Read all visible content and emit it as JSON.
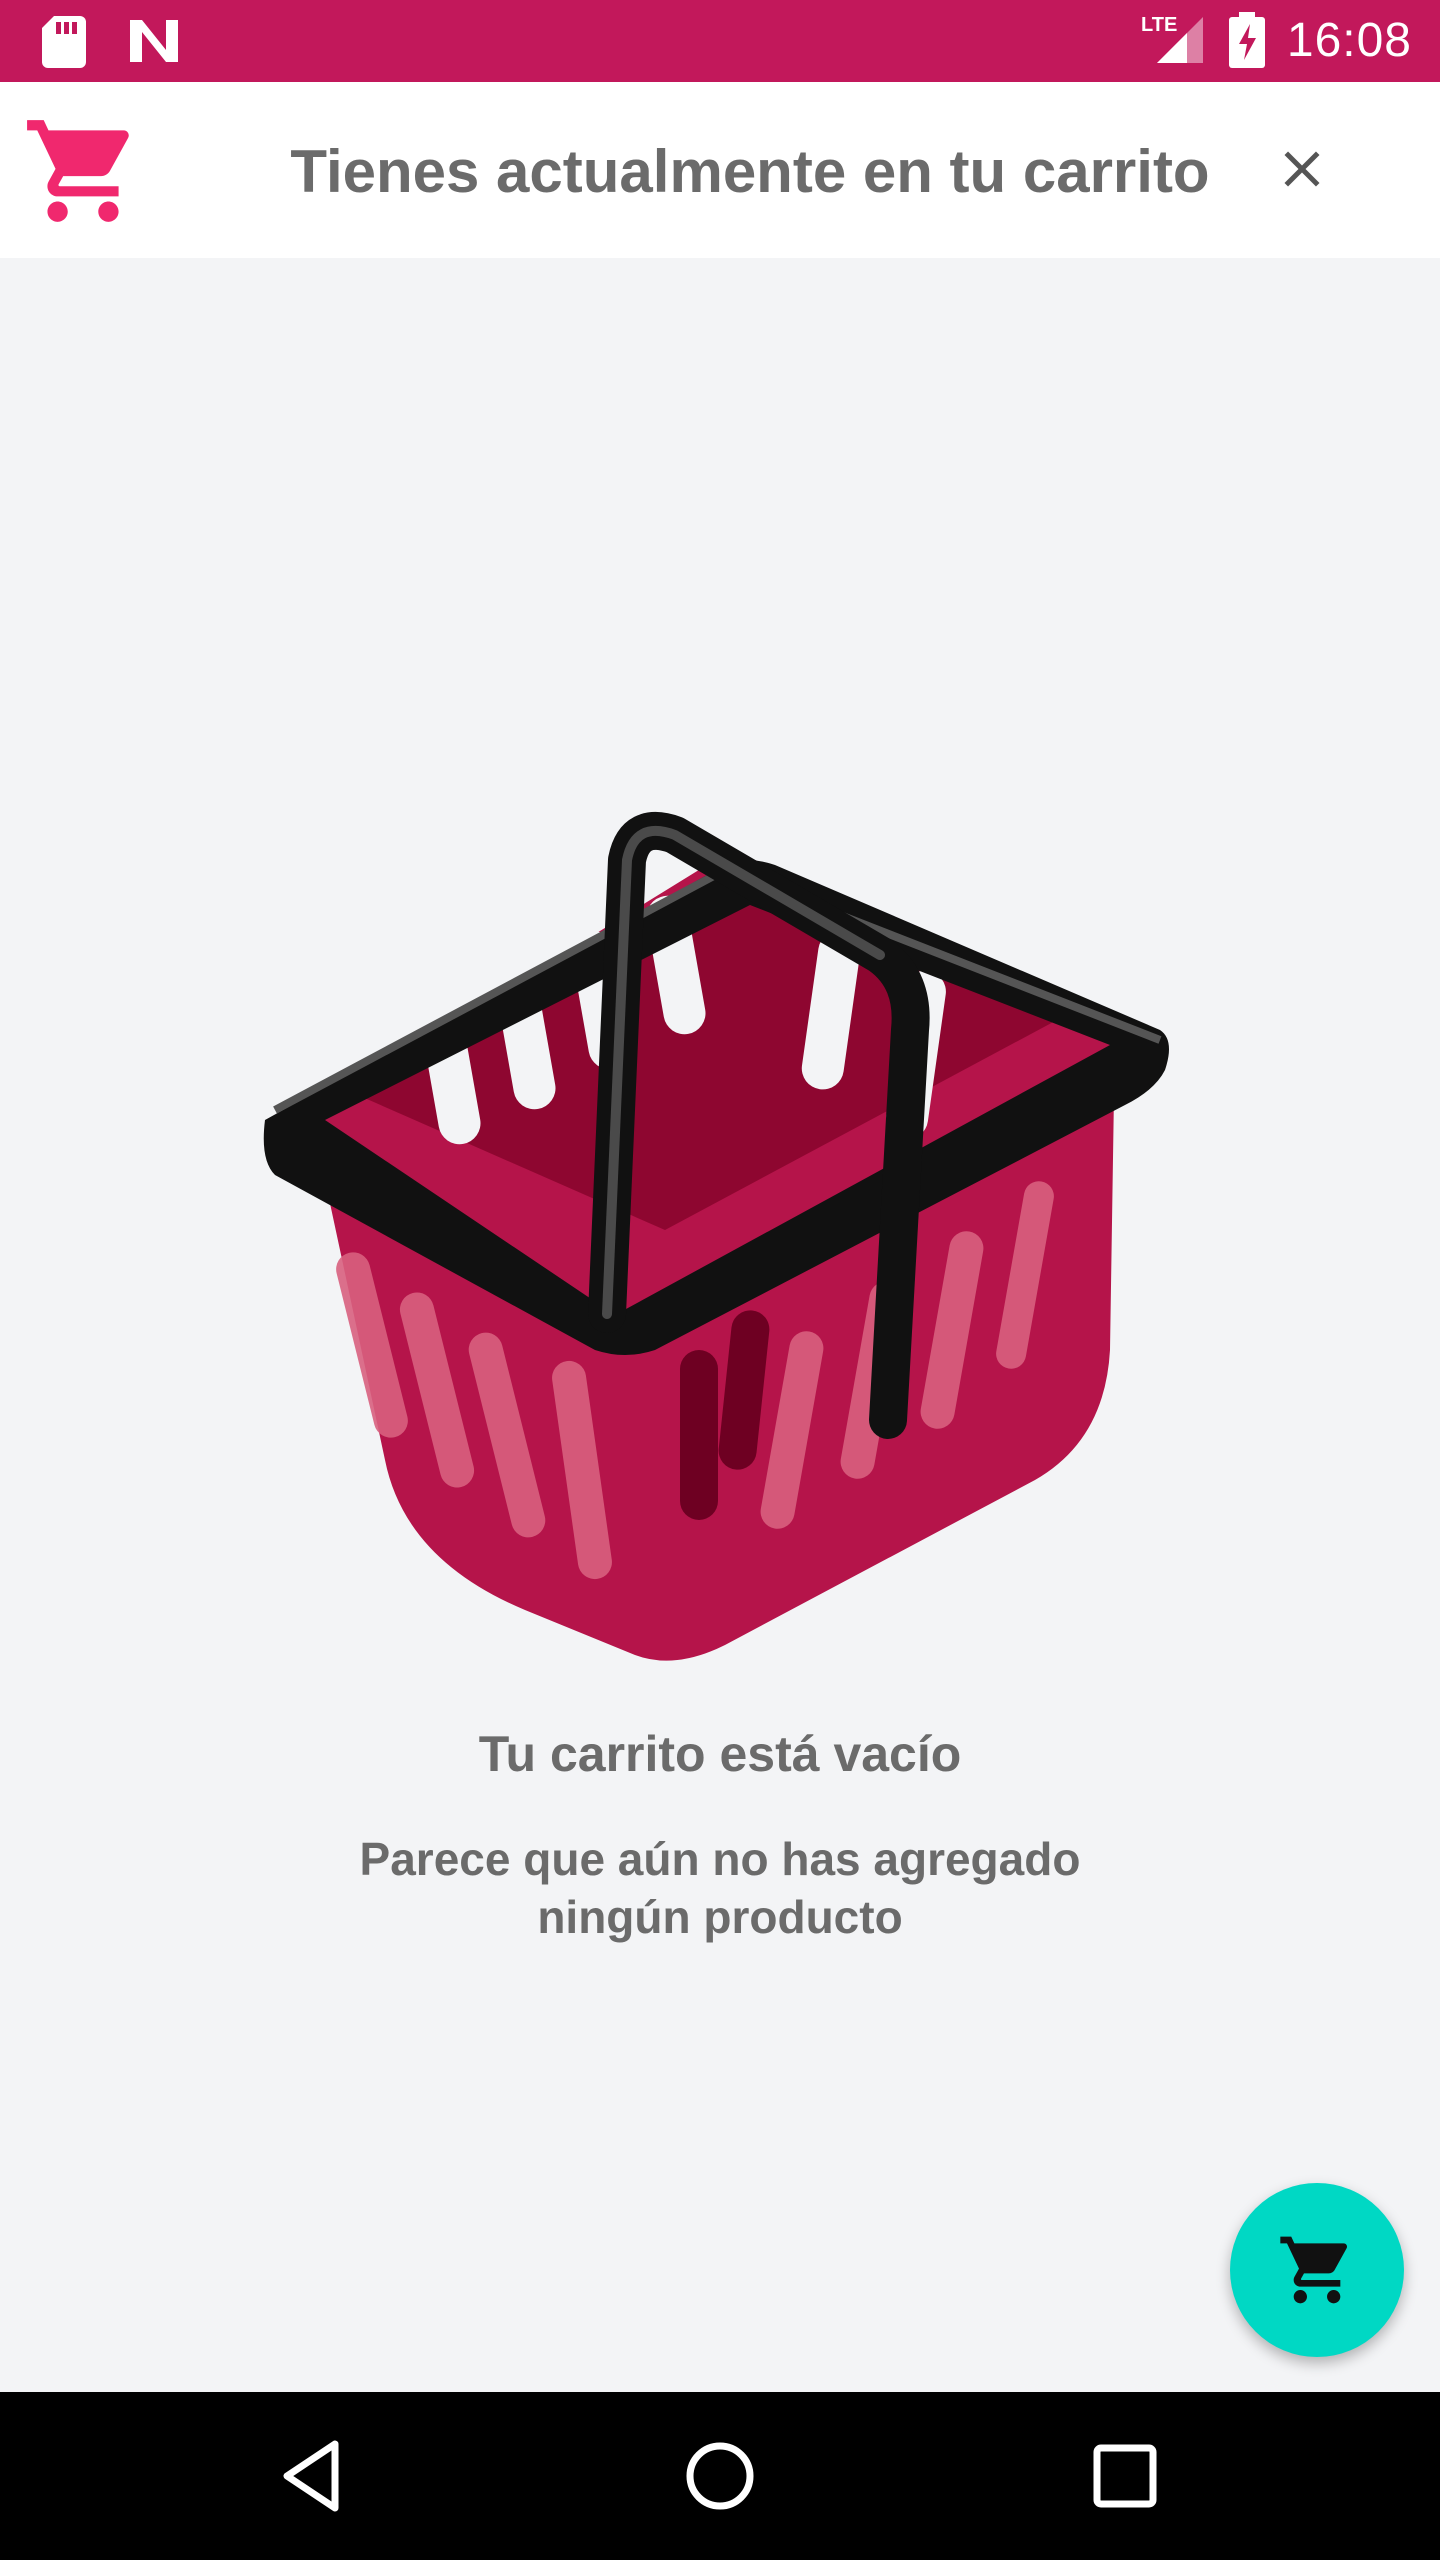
{
  "status_bar": {
    "time": "16:08",
    "network": "LTE",
    "icons": [
      "sd-card-icon",
      "n-notification-icon",
      "lte-signal-icon",
      "battery-charging-icon"
    ],
    "color": "#c2185b"
  },
  "header": {
    "title": "Tienes actualmente en tu carrito",
    "logo_icon": "shopping-cart-icon",
    "close_icon": "close-icon",
    "accent": "#f0286e"
  },
  "empty_state": {
    "illustration": "shopping-basket-icon",
    "title": "Tu carrito está vacío",
    "subtitle": "Parece que aún no has agregado ningún producto"
  },
  "fab": {
    "icon": "cart-icon",
    "color": "#00d8c4"
  },
  "nav_bar": {
    "buttons": [
      "back-icon",
      "home-icon",
      "recents-icon"
    ]
  }
}
